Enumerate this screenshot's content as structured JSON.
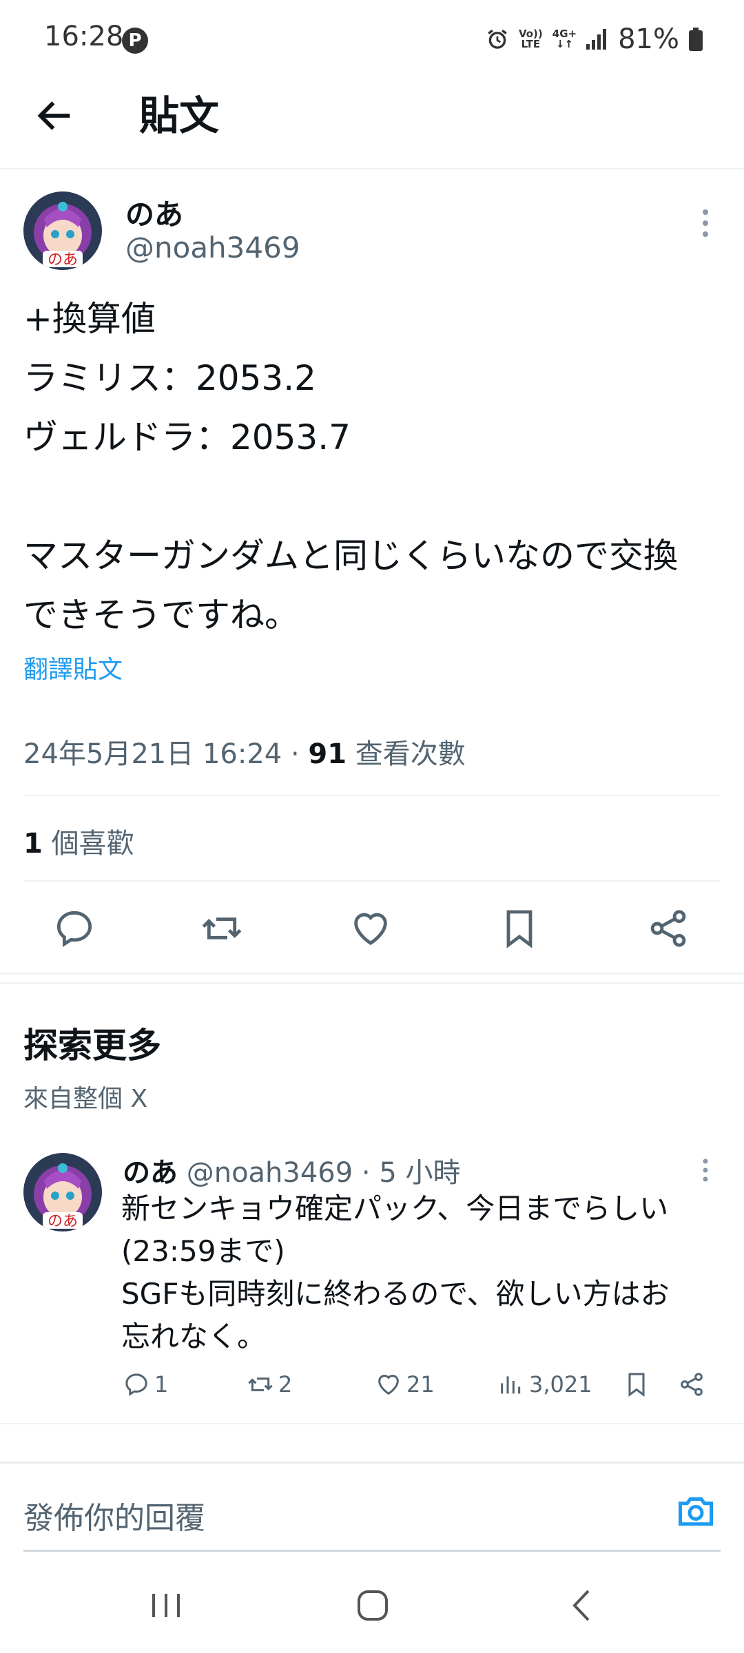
{
  "status_bar": {
    "time": "16:28",
    "notif_icon_letter": "P",
    "volte_top": "Vo))",
    "volte_bottom": "LTE",
    "network_label": "4G+",
    "battery": "81%"
  },
  "header": {
    "title": "貼文",
    "back_icon": "arrow-left-icon"
  },
  "tweet": {
    "author_name": "のあ",
    "author_handle": "@noah3469",
    "body": "+換算値\nラミリス：2053.2\nヴェルドラ：2053.7\n\nマスターガンダムと同じくらいなので交換\nできそうですね。",
    "translate_label": "翻譯貼文",
    "timestamp": "24年5月21日 16:24",
    "separator": "·",
    "views_count": "91",
    "views_label": "查看次數",
    "likes_count": "1",
    "likes_label": "個喜歡",
    "actions": [
      "reply-icon",
      "retweet-icon",
      "like-icon",
      "bookmark-icon",
      "share-icon"
    ]
  },
  "explore": {
    "title": "探索更多",
    "subtitle": "來自整個 X"
  },
  "related_tweet": {
    "author_name": "のあ",
    "author_handle": "@noah3469",
    "time_ago": "· 5 小時",
    "text": "新センキョウ確定パック、今日までらしい\n(23:59まで)\nSGFも同時刻に終わるので、欲しい方はお\n忘れなく。",
    "replies": "1",
    "retweets": "2",
    "likes": "21",
    "views": "3,021"
  },
  "reply_bar": {
    "placeholder": "發佈你的回覆"
  },
  "colors": {
    "accent": "#1d9bf0",
    "secondary_text": "#536471",
    "divider": "#eff3f4"
  }
}
